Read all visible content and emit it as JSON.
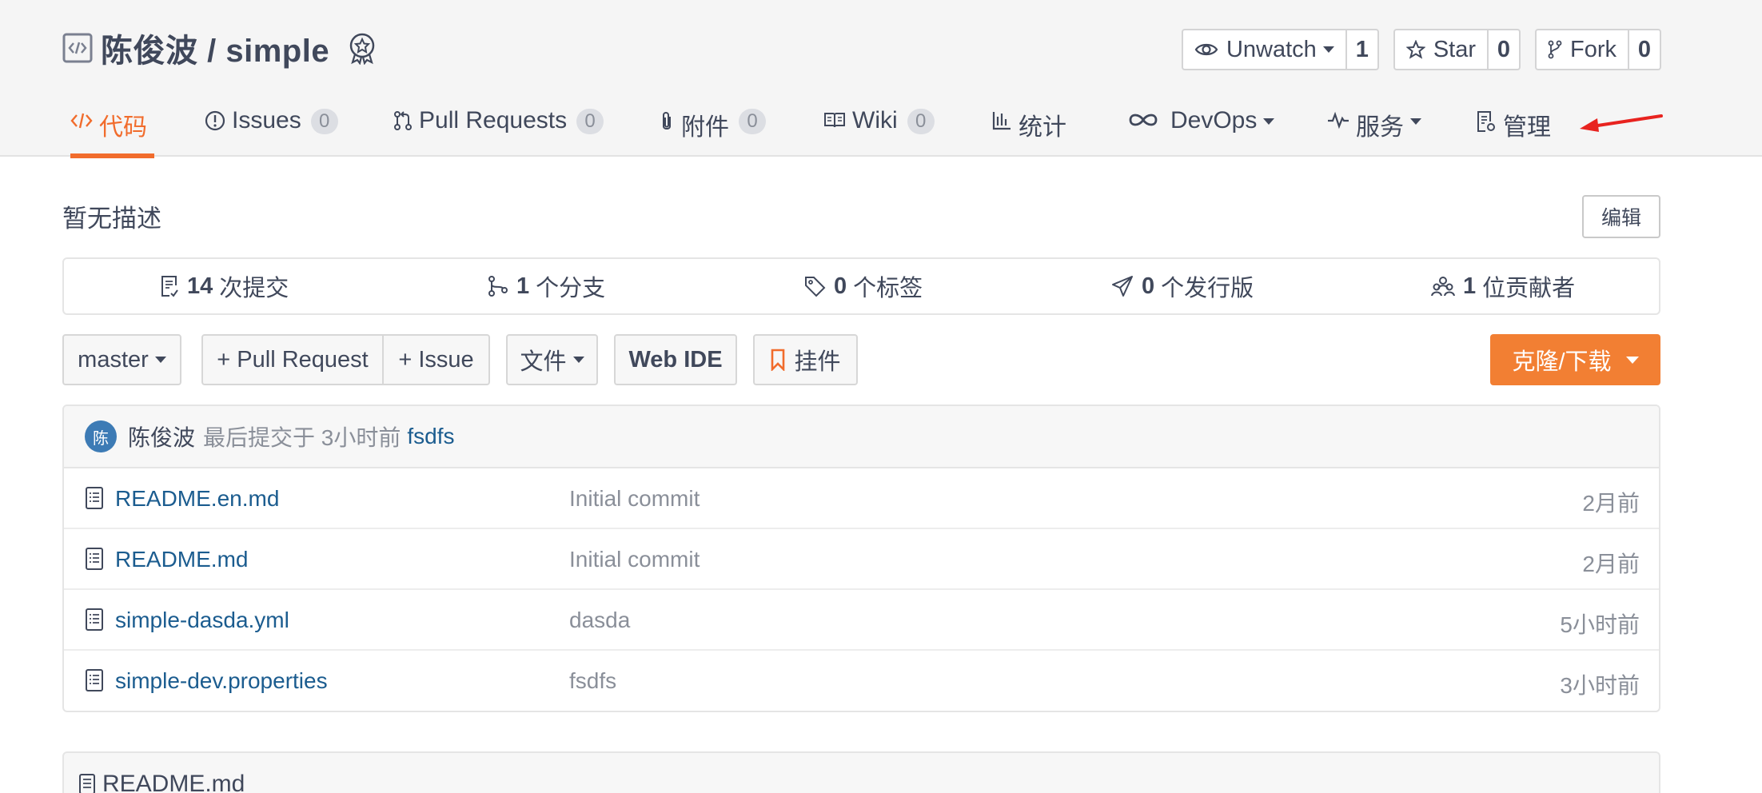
{
  "repo": {
    "owner": "陈俊波",
    "separator": " / ",
    "name": "simple"
  },
  "header_actions": {
    "watch": {
      "label": "Unwatch",
      "count": "1"
    },
    "star": {
      "label": "Star",
      "count": "0"
    },
    "fork": {
      "label": "Fork",
      "count": "0"
    }
  },
  "tabs": [
    {
      "label": "代码"
    },
    {
      "label": "Issues",
      "count": "0"
    },
    {
      "label": "Pull Requests",
      "count": "0"
    },
    {
      "label": "附件",
      "count": "0"
    },
    {
      "label": "Wiki",
      "count": "0"
    },
    {
      "label": "统计"
    },
    {
      "label": "DevOps"
    },
    {
      "label": "服务"
    },
    {
      "label": "管理"
    }
  ],
  "description": "暂无描述",
  "edit_label": "编辑",
  "stats": [
    {
      "value": "14",
      "label": "次提交"
    },
    {
      "value": "1",
      "label": "个分支"
    },
    {
      "value": "0",
      "label": "个标签"
    },
    {
      "value": "0",
      "label": "个发行版"
    },
    {
      "value": "1",
      "label": "位贡献者"
    }
  ],
  "toolbar": {
    "branch": "master",
    "pull_request": "+ Pull Request",
    "issue": "+ Issue",
    "file": "文件",
    "web_ide": "Web IDE",
    "widget": "挂件",
    "clone": "克隆/下载"
  },
  "last_commit": {
    "avatar": "陈",
    "author": "陈俊波",
    "meta": "最后提交于 3小时前",
    "message": "fsdfs"
  },
  "files": [
    {
      "name": "README.en.md",
      "message": "Initial commit",
      "time": "2月前"
    },
    {
      "name": "README.md",
      "message": "Initial commit",
      "time": "2月前"
    },
    {
      "name": "simple-dasda.yml",
      "message": "dasda",
      "time": "5小时前"
    },
    {
      "name": "simple-dev.properties",
      "message": "fsdfs",
      "time": "3小时前"
    }
  ],
  "readme": {
    "title": "README.md"
  },
  "colors": {
    "accent": "#f16c2c",
    "link": "#1b5c8f",
    "clone_bg": "#f27f33",
    "arrow": "#e8231f"
  }
}
